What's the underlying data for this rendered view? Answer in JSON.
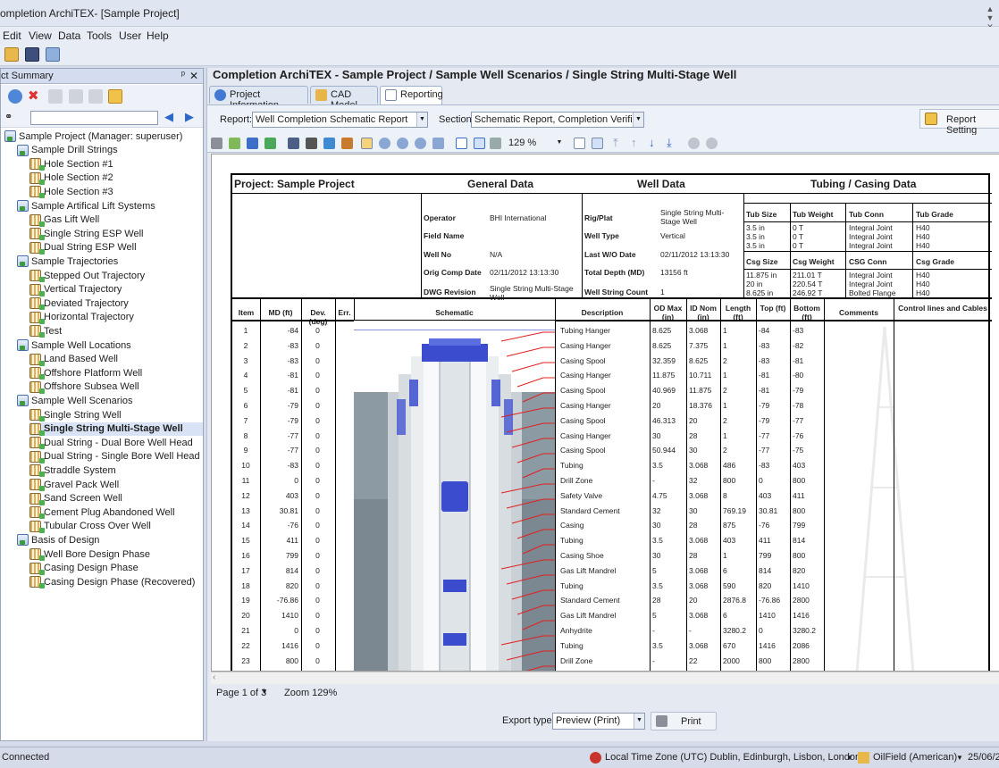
{
  "window": {
    "title": "ompletion ArchiTEX- [Sample Project]",
    "controls": [
      "▲",
      "▼",
      "✕"
    ]
  },
  "menu": [
    "Edit",
    "View",
    "Data",
    "Tools",
    "User",
    "Help"
  ],
  "left_panel": {
    "title": "ct Summary",
    "pin": "ᵖ",
    "close": "✕"
  },
  "tree": [
    {
      "label": "Sample Project (Manager: superuser)",
      "level": 0,
      "icon": "folder"
    },
    {
      "label": "Sample Drill Strings",
      "level": 1,
      "icon": "folder"
    },
    {
      "label": "Hole Section #1",
      "level": 2,
      "icon": "well"
    },
    {
      "label": "Hole Section #2",
      "level": 2,
      "icon": "well"
    },
    {
      "label": "Hole Section #3",
      "level": 2,
      "icon": "well"
    },
    {
      "label": "Sample Artifical Lift Systems",
      "level": 1,
      "icon": "folder"
    },
    {
      "label": "Gas Lift Well",
      "level": 2,
      "icon": "well"
    },
    {
      "label": "Single String ESP Well",
      "level": 2,
      "icon": "well"
    },
    {
      "label": "Dual String ESP Well",
      "level": 2,
      "icon": "well"
    },
    {
      "label": "Sample Trajectories",
      "level": 1,
      "icon": "folder"
    },
    {
      "label": "Stepped Out Trajectory",
      "level": 2,
      "icon": "well"
    },
    {
      "label": "Vertical Trajectory",
      "level": 2,
      "icon": "well"
    },
    {
      "label": "Deviated Trajectory",
      "level": 2,
      "icon": "well"
    },
    {
      "label": "Horizontal Trajectory",
      "level": 2,
      "icon": "well"
    },
    {
      "label": "Test",
      "level": 2,
      "icon": "well"
    },
    {
      "label": "Sample Well Locations",
      "level": 1,
      "icon": "folder"
    },
    {
      "label": "Land Based Well",
      "level": 2,
      "icon": "well"
    },
    {
      "label": "Offshore Platform Well",
      "level": 2,
      "icon": "well"
    },
    {
      "label": "Offshore Subsea Well",
      "level": 2,
      "icon": "well"
    },
    {
      "label": "Sample Well Scenarios",
      "level": 1,
      "icon": "folder"
    },
    {
      "label": "Single String Well",
      "level": 2,
      "icon": "well"
    },
    {
      "label": "Single String Multi-Stage Well",
      "level": 2,
      "icon": "well",
      "selected": true
    },
    {
      "label": "Dual String - Dual Bore Well Head",
      "level": 2,
      "icon": "well"
    },
    {
      "label": "Dual String - Single Bore Well Head",
      "level": 2,
      "icon": "well"
    },
    {
      "label": "Straddle System",
      "level": 2,
      "icon": "well"
    },
    {
      "label": "Gravel Pack Well",
      "level": 2,
      "icon": "well"
    },
    {
      "label": "Sand Screen Well",
      "level": 2,
      "icon": "well"
    },
    {
      "label": "Cement Plug Abandoned Well",
      "level": 2,
      "icon": "well"
    },
    {
      "label": "Tubular Cross Over Well",
      "level": 2,
      "icon": "well"
    },
    {
      "label": "Basis of Design",
      "level": 1,
      "icon": "folder"
    },
    {
      "label": "Well Bore Design Phase",
      "level": 2,
      "icon": "well"
    },
    {
      "label": "Casing Design Phase",
      "level": 2,
      "icon": "well"
    },
    {
      "label": "Casing Design Phase (Recovered)",
      "level": 2,
      "icon": "well"
    }
  ],
  "breadcrumb": "Completion ArchiTEX - Sample Project / Sample Well Scenarios / Single String Multi-Stage Well",
  "tabs": [
    "Project Information",
    "CAD Model",
    "Reporting"
  ],
  "report_label": "Report:",
  "report_value": "Well Completion Schematic Report",
  "section_label": "Section:",
  "section_value": "Schematic Report, Completion Verificat...",
  "report_settings": "Report Setting",
  "zoom_value": "129 %",
  "sheet": {
    "project_label": "Project:  Sample Project",
    "general_data": "General Data",
    "well_data": "Well Data",
    "tubing_casing": "Tubing / Casing Data",
    "general": [
      [
        "Operator",
        "BHI International"
      ],
      [
        "Field Name",
        ""
      ],
      [
        "Well No",
        "N/A"
      ],
      [
        "Orig Comp Date",
        "02/11/2012 13:13:30"
      ],
      [
        "DWG Revision",
        "Single String Multi-Stage Well"
      ]
    ],
    "well": [
      [
        "Rig/Plat",
        "Single String Multi-Stage Well"
      ],
      [
        "Well Type",
        "Vertical"
      ],
      [
        "Last W/O Date",
        "02/11/2012 13:13:30"
      ],
      [
        "Total Depth (MD)",
        "13156 ft"
      ],
      [
        "Well String Count",
        "1"
      ]
    ],
    "tub_headers": [
      "Tub Size",
      "Tub Weight",
      "Tub Conn",
      "Tub Grade"
    ],
    "tub_rows": [
      [
        "3.5 in",
        "0 T",
        "Integral Joint",
        "H40"
      ],
      [
        "3.5 in",
        "0 T",
        "Integral Joint",
        "H40"
      ],
      [
        "3.5 in",
        "0 T",
        "Integral Joint",
        "H40"
      ]
    ],
    "csg_headers": [
      "Csg Size",
      "Csg Weight",
      "CSG Conn",
      "Csg Grade"
    ],
    "csg_rows": [
      [
        "11.875 in",
        "211.01 T",
        "Integral Joint",
        "H40"
      ],
      [
        "20 in",
        "220.54 T",
        "Integral Joint",
        "H40"
      ],
      [
        "8.625 in",
        "246.92 T",
        "Bolted Flange",
        "H40"
      ]
    ],
    "col_headers": [
      "Item",
      "MD (ft)",
      "Dev. (deg)",
      "Err.",
      "Schematic",
      "Description",
      "OD Max (in)",
      "ID Nom (in)",
      "Length (ft)",
      "Top (ft)",
      "Bottom (ft)",
      "Comments",
      "Control lines and Cables"
    ],
    "rows": [
      [
        "1",
        "-84",
        "0",
        "",
        "",
        "Tubing Hanger",
        "8.625",
        "3.068",
        "1",
        "-84",
        "-83"
      ],
      [
        "2",
        "-83",
        "0",
        "",
        "",
        "Casing Hanger",
        "8.625",
        "7.375",
        "1",
        "-83",
        "-82"
      ],
      [
        "3",
        "-83",
        "0",
        "",
        "",
        "Casing Spool",
        "32.359",
        "8.625",
        "2",
        "-83",
        "-81"
      ],
      [
        "4",
        "-81",
        "0",
        "",
        "",
        "Casing Hanger",
        "11.875",
        "10.711",
        "1",
        "-81",
        "-80"
      ],
      [
        "5",
        "-81",
        "0",
        "",
        "",
        "Casing Spool",
        "40.969",
        "11.875",
        "2",
        "-81",
        "-79"
      ],
      [
        "6",
        "-79",
        "0",
        "",
        "",
        "Casing Hanger",
        "20",
        "18.376",
        "1",
        "-79",
        "-78"
      ],
      [
        "7",
        "-79",
        "0",
        "",
        "",
        "Casing Spool",
        "46.313",
        "20",
        "2",
        "-79",
        "-77"
      ],
      [
        "8",
        "-77",
        "0",
        "",
        "",
        "Casing Hanger",
        "30",
        "28",
        "1",
        "-77",
        "-76"
      ],
      [
        "9",
        "-77",
        "0",
        "",
        "",
        "Casing Spool",
        "50.944",
        "30",
        "2",
        "-77",
        "-75"
      ],
      [
        "10",
        "-83",
        "0",
        "",
        "",
        "Tubing",
        "3.5",
        "3.068",
        "486",
        "-83",
        "403"
      ],
      [
        "11",
        "0",
        "0",
        "",
        "",
        "Drill Zone",
        "-",
        "32",
        "800",
        "0",
        "800"
      ],
      [
        "12",
        "403",
        "0",
        "",
        "",
        "Safety Valve",
        "4.75",
        "3.068",
        "8",
        "403",
        "411"
      ],
      [
        "13",
        "30.81",
        "0",
        "",
        "",
        "Standard Cement",
        "32",
        "30",
        "769.19",
        "30.81",
        "800"
      ],
      [
        "14",
        "-76",
        "0",
        "",
        "",
        "Casing",
        "30",
        "28",
        "875",
        "-76",
        "799"
      ],
      [
        "15",
        "411",
        "0",
        "",
        "",
        "Tubing",
        "3.5",
        "3.068",
        "403",
        "411",
        "814"
      ],
      [
        "16",
        "799",
        "0",
        "",
        "",
        "Casing Shoe",
        "30",
        "28",
        "1",
        "799",
        "800"
      ],
      [
        "17",
        "814",
        "0",
        "",
        "",
        "Gas Lift Mandrel",
        "5",
        "3.068",
        "6",
        "814",
        "820"
      ],
      [
        "18",
        "820",
        "0",
        "",
        "",
        "Tubing",
        "3.5",
        "3.068",
        "590",
        "820",
        "1410"
      ],
      [
        "19",
        "-76.86",
        "0",
        "",
        "",
        "Standard Cement",
        "28",
        "20",
        "2876.8",
        "-76.86",
        "2800"
      ],
      [
        "20",
        "1410",
        "0",
        "",
        "",
        "Gas Lift Mandrel",
        "5",
        "3.068",
        "6",
        "1410",
        "1416"
      ],
      [
        "21",
        "0",
        "0",
        "",
        "",
        "Anhydrite",
        "-",
        "-",
        "3280.2",
        "0",
        "3280.2"
      ],
      [
        "22",
        "1416",
        "0",
        "",
        "",
        "Tubing",
        "3.5",
        "3.068",
        "670",
        "1416",
        "2086"
      ],
      [
        "23",
        "800",
        "0",
        "",
        "",
        "Drill Zone",
        "-",
        "22",
        "2000",
        "800",
        "2800"
      ]
    ]
  },
  "page_info": "Page 1 of 3",
  "zoom_info": "Zoom 129%",
  "export_label": "Export type",
  "export_value": "Preview (Print)",
  "print_label": "Print",
  "status": {
    "connection": "Connected",
    "timezone": "Local Time Zone (UTC) Dublin, Edinburgh, Lisbon, London",
    "units": "OilField (American)",
    "date": "25/06/2"
  },
  "colors": {
    "accent": "#2f4ea3",
    "tubing": "#3b4ccf",
    "wire": "#e02020"
  }
}
